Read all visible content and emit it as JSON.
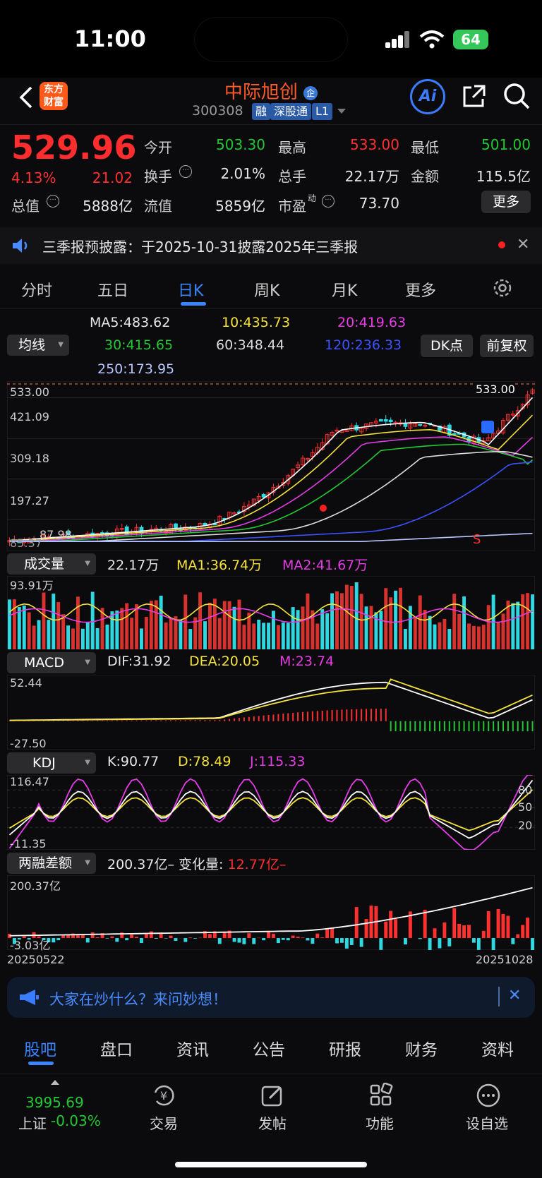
{
  "status_bar": {
    "time": "11:00",
    "battery": "64"
  },
  "header": {
    "logo_line1": "东方",
    "logo_line2": "财富",
    "stock_name": "中际旭创",
    "stock_code": "300308",
    "tags": [
      "融",
      "深股通",
      "L1"
    ]
  },
  "quote": {
    "price": "529.96",
    "change_pct": "4.13%",
    "change_amt": "21.02",
    "open_label": "今开",
    "open": "503.30",
    "high_label": "最高",
    "high": "533.00",
    "low_label": "最低",
    "low": "501.00",
    "turnover_label": "换手",
    "turnover": "2.01%",
    "volume_label": "总手",
    "volume": "22.17万",
    "amount_label": "金额",
    "amount": "115.5亿",
    "mktcap_label": "总值",
    "mktcap": "5888亿",
    "float_label": "流值",
    "float": "5859亿",
    "pe_label": "市盈",
    "pe_sup": "动",
    "pe": "73.70",
    "more": "更多"
  },
  "notice": {
    "text": "三季报预披露：于2025-10-31披露2025年三季报"
  },
  "chart_tabs": [
    "分时",
    "五日",
    "日K",
    "周K",
    "月K",
    "更多"
  ],
  "ma": {
    "selector": "均线",
    "ma5": "MA5:483.62",
    "ma10": "10:435.73",
    "ma20": "20:419.63",
    "ma30": "30:415.65",
    "ma60": "60:348.44",
    "ma120": "120:236.33",
    "ma250": "250:173.95",
    "dk_button": "DK点",
    "adjust_button": "前复权"
  },
  "price_axis": {
    "high_label": "533.00",
    "max_label": "533.00",
    "l2": "421.09",
    "l3": "309.18",
    "l4": "197.27",
    "l5": "87.98",
    "l6": "85.37",
    "sell_mark": "S"
  },
  "volume_panel": {
    "selector": "成交量",
    "vol": "22.17万",
    "ma1": "MA1:36.74万",
    "ma2": "MA2:41.67万",
    "top": "93.91万"
  },
  "macd_panel": {
    "selector": "MACD",
    "dif": "DIF:31.92",
    "dea": "DEA:20.05",
    "m": "M:23.74",
    "top": "52.44",
    "bottom": "-27.50"
  },
  "kdj_panel": {
    "selector": "KDJ",
    "k": "K:90.77",
    "d": "D:78.49",
    "j": "J:115.33",
    "top": "116.47",
    "bottom": "-11.35",
    "r80": "80",
    "r50": "50",
    "r20": "20"
  },
  "margin_panel": {
    "selector": "两融差额",
    "value": "200.37亿",
    "change_label": "变化量:",
    "change": "12.77亿",
    "top": "200.37亿",
    "bottom": "-3.03亿",
    "date_start": "20250522",
    "date_end": "20251028"
  },
  "chat_bar": {
    "text": "大家在炒什么？来问妙想！"
  },
  "bottom_tabs": [
    "股吧",
    "盘口",
    "资讯",
    "公告",
    "研报",
    "财务",
    "资料"
  ],
  "dock": {
    "index_value": "3995.69",
    "index_name": "上证",
    "index_change": "-0.03%",
    "items": [
      "交易",
      "发帖",
      "功能",
      "设自选"
    ]
  },
  "colors": {
    "up": "#ff3030",
    "down": "#22c832",
    "brand": "#ff5a2a"
  }
}
